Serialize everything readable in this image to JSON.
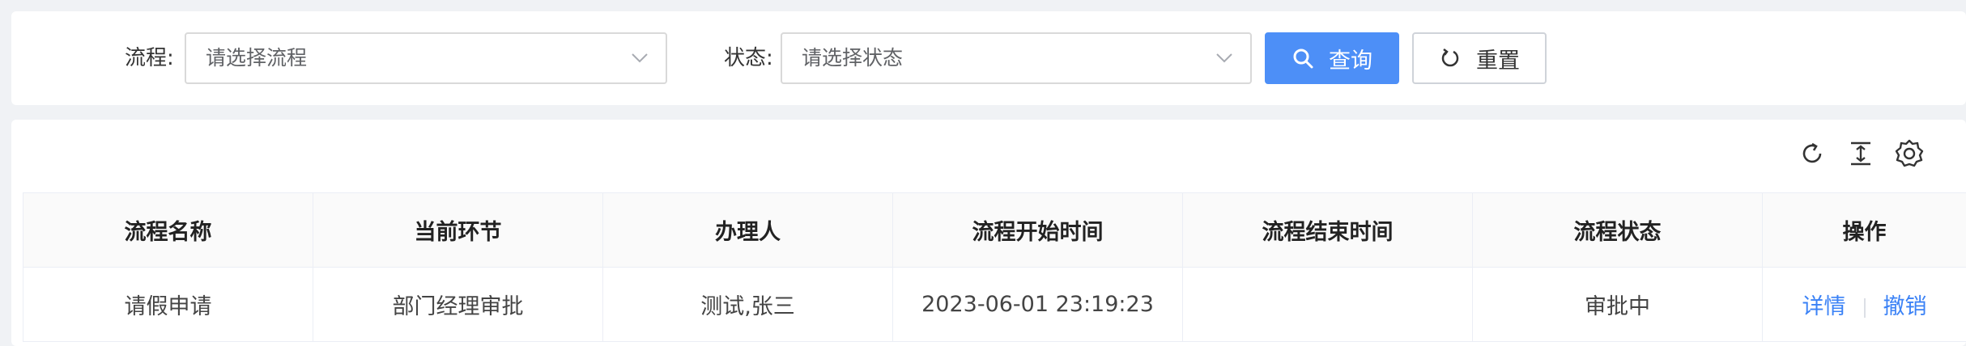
{
  "search": {
    "process_label": "流程:",
    "process_placeholder": "请选择流程",
    "status_label": "状态:",
    "status_placeholder": "请选择状态",
    "query_label": "查询",
    "reset_label": "重置"
  },
  "toolbar": {
    "icons": [
      "refresh-icon",
      "column-height-icon",
      "settings-icon"
    ]
  },
  "table": {
    "headers": [
      "流程名称",
      "当前环节",
      "办理人",
      "流程开始时间",
      "流程结束时间",
      "流程状态",
      "操作"
    ],
    "rows": [
      {
        "name": "请假申请",
        "current_step": "部门经理审批",
        "handler": "测试,张三",
        "start_time": "2023-06-01 23:19:23",
        "end_time": "",
        "status": "审批中",
        "actions": [
          "详情",
          "撤销"
        ]
      }
    ]
  },
  "colors": {
    "primary": "#4d8ff7",
    "link": "#3b82f6",
    "background": "#f0f2f5"
  }
}
